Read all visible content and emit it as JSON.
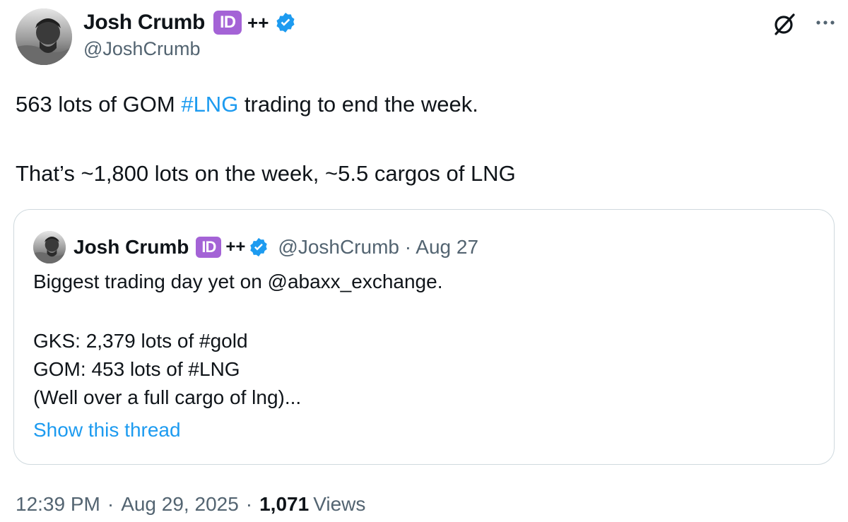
{
  "author": {
    "display_name": "Josh Crumb",
    "id_badge": "ID",
    "plus": "++",
    "handle": "@JoshCrumb"
  },
  "tweet": {
    "line1_prefix": "563 lots of GOM ",
    "line1_hashtag": "#LNG",
    "line1_suffix": " trading to end the week.",
    "line2": "That’s ~1,800 lots on the week, ~5.5 cargos of LNG"
  },
  "quote": {
    "display_name": "Josh Crumb",
    "id_badge": "ID",
    "plus": "++",
    "handle_date": "@JoshCrumb · Aug 27",
    "line1": "Biggest trading day yet on @abaxx_exchange.",
    "line2": "GKS: 2,379 lots of #gold",
    "line3": "GOM: 453 lots of #LNG",
    "line4": "(Well over a full cargo of lng)...",
    "show_thread": "Show this thread"
  },
  "meta": {
    "time": "12:39 PM",
    "date": "Aug 29, 2025",
    "views_count": "1,071",
    "views_label": "Views",
    "separator": "·"
  },
  "icons": {
    "verified": "verified-badge-icon",
    "grok": "grok-icon",
    "more": "more-icon"
  },
  "colors": {
    "link": "#1d9bf0",
    "secondary": "#536471",
    "id_badge": "#a463d6",
    "verified": "#1d9bf0"
  }
}
